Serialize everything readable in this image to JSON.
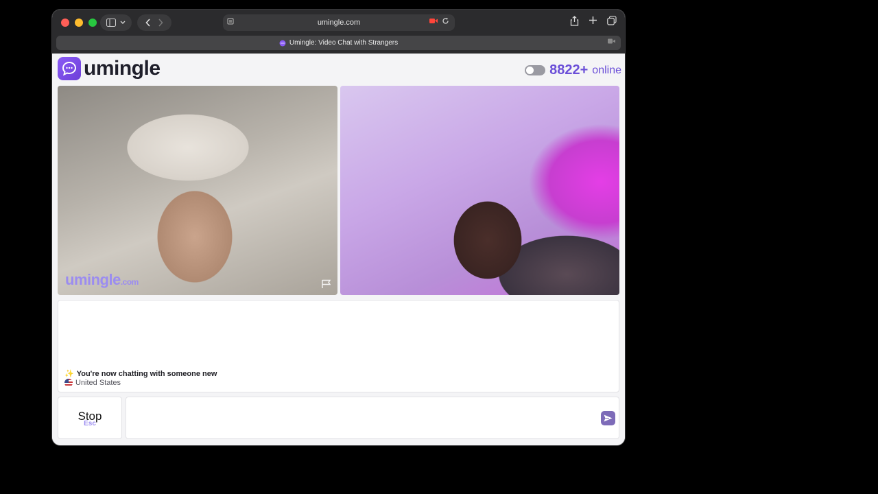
{
  "browser": {
    "address": "umingle.com",
    "tab_title": "Umingle: Video Chat with Strangers"
  },
  "header": {
    "logo_text": "umingle",
    "online_count": "8822+",
    "online_label": "online"
  },
  "video": {
    "watermark_main": "umingle",
    "watermark_suffix": ".com"
  },
  "chat": {
    "system_message": "You're now chatting with someone new",
    "partner_country": "United States"
  },
  "controls": {
    "stop_label": "Stop",
    "stop_hint": "Esc",
    "message_placeholder": ""
  },
  "colors": {
    "brand": "#7c4ef0",
    "accent_text": "#6b4fd8"
  }
}
